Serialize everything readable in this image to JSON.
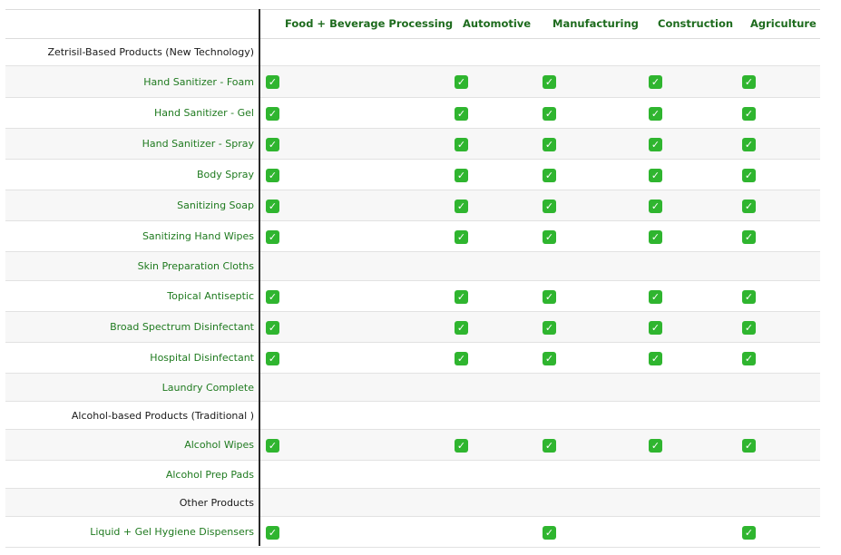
{
  "columns": [
    "Food + Beverage Processing",
    "Automotive",
    "Manufacturing",
    "Construction",
    "Agriculture"
  ],
  "check_glyph": "✓",
  "colors": {
    "header_text": "#1d6b1d",
    "product_text": "#1f7a1f",
    "section_text": "#1a1a1a",
    "check_bg": "#2fb52f"
  },
  "rows": [
    {
      "label": "Zetrisil-Based Products (New Technology)",
      "type": "section",
      "checks": [
        false,
        false,
        false,
        false,
        false
      ]
    },
    {
      "label": "Hand Sanitizer - Foam",
      "type": "product",
      "checks": [
        true,
        true,
        true,
        true,
        true
      ]
    },
    {
      "label": "Hand Sanitizer - Gel",
      "type": "product",
      "checks": [
        true,
        true,
        true,
        true,
        true
      ]
    },
    {
      "label": "Hand Sanitizer - Spray",
      "type": "product",
      "checks": [
        true,
        true,
        true,
        true,
        true
      ]
    },
    {
      "label": "Body Spray",
      "type": "product",
      "checks": [
        true,
        true,
        true,
        true,
        true
      ]
    },
    {
      "label": "Sanitizing Soap",
      "type": "product",
      "checks": [
        true,
        true,
        true,
        true,
        true
      ]
    },
    {
      "label": "Sanitizing Hand Wipes",
      "type": "product",
      "checks": [
        true,
        true,
        true,
        true,
        true
      ]
    },
    {
      "label": "Skin Preparation Cloths",
      "type": "product",
      "checks": [
        false,
        false,
        false,
        false,
        false
      ]
    },
    {
      "label": "Topical Antiseptic",
      "type": "product",
      "checks": [
        true,
        true,
        true,
        true,
        true
      ]
    },
    {
      "label": "Broad Spectrum Disinfectant",
      "type": "product",
      "checks": [
        true,
        true,
        true,
        true,
        true
      ]
    },
    {
      "label": "Hospital Disinfectant",
      "type": "product",
      "checks": [
        true,
        true,
        true,
        true,
        true
      ]
    },
    {
      "label": "Laundry Complete",
      "type": "product",
      "checks": [
        false,
        false,
        false,
        false,
        false
      ]
    },
    {
      "label": "Alcohol-based Products (Traditional )",
      "type": "section",
      "checks": [
        false,
        false,
        false,
        false,
        false
      ]
    },
    {
      "label": "Alcohol Wipes",
      "type": "product",
      "checks": [
        true,
        true,
        true,
        true,
        true
      ]
    },
    {
      "label": "Alcohol Prep Pads",
      "type": "product",
      "checks": [
        false,
        false,
        false,
        false,
        false
      ]
    },
    {
      "label": "Other Products",
      "type": "section",
      "checks": [
        false,
        false,
        false,
        false,
        false
      ]
    },
    {
      "label": "Liquid + Gel Hygiene Dispensers",
      "type": "product",
      "checks": [
        true,
        false,
        true,
        false,
        true
      ]
    }
  ]
}
